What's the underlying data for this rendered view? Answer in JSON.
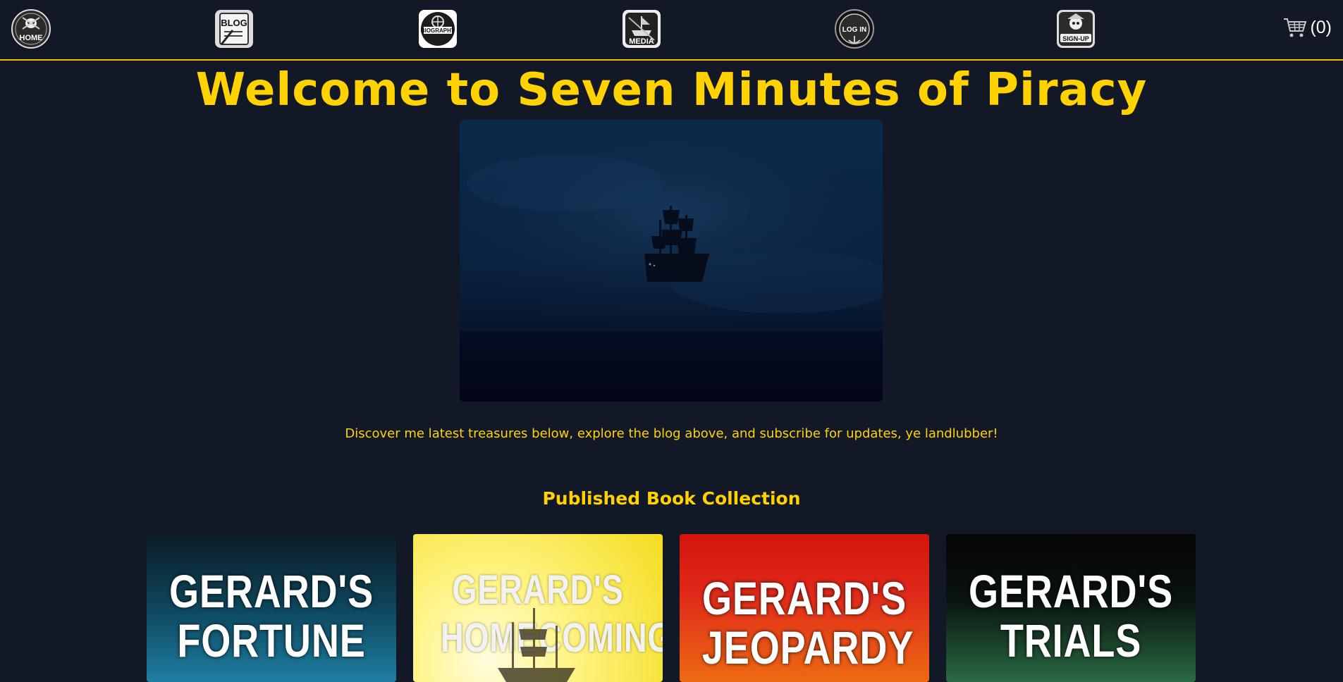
{
  "nav": {
    "items": [
      {
        "label": "HOME",
        "icon": "skull-crossbones-icon"
      },
      {
        "label": "BLOG",
        "icon": "scroll-quill-icon"
      },
      {
        "label": "BIOGRAPHY",
        "icon": "ship-wheel-icon"
      },
      {
        "label": "MEDIA",
        "icon": "ship-sword-icon"
      },
      {
        "label": "LOG IN",
        "icon": "anchor-badge-icon"
      },
      {
        "label": "SIGN-UP",
        "icon": "pirate-badge-icon"
      }
    ],
    "cart": {
      "icon": "cart-icon",
      "count_label": "(0)"
    }
  },
  "page": {
    "title": "Welcome to Seven Minutes of Piracy",
    "tagline": "Discover me latest treasures below, explore the blog above, and subscribe for updates, ye landlubber!",
    "section_title": "Published Book Collection"
  },
  "books": [
    {
      "title": "GERARD'S\nFORTUNE"
    },
    {
      "title": "GERARD'S\nHOMECOMING"
    },
    {
      "title": "GERARD'S\nJEOPARDY"
    },
    {
      "title": "GERARD'S\nTRIALS"
    }
  ],
  "colors": {
    "background": "#121826",
    "accent": "#FFD200",
    "nav_border": "#E8C300"
  }
}
